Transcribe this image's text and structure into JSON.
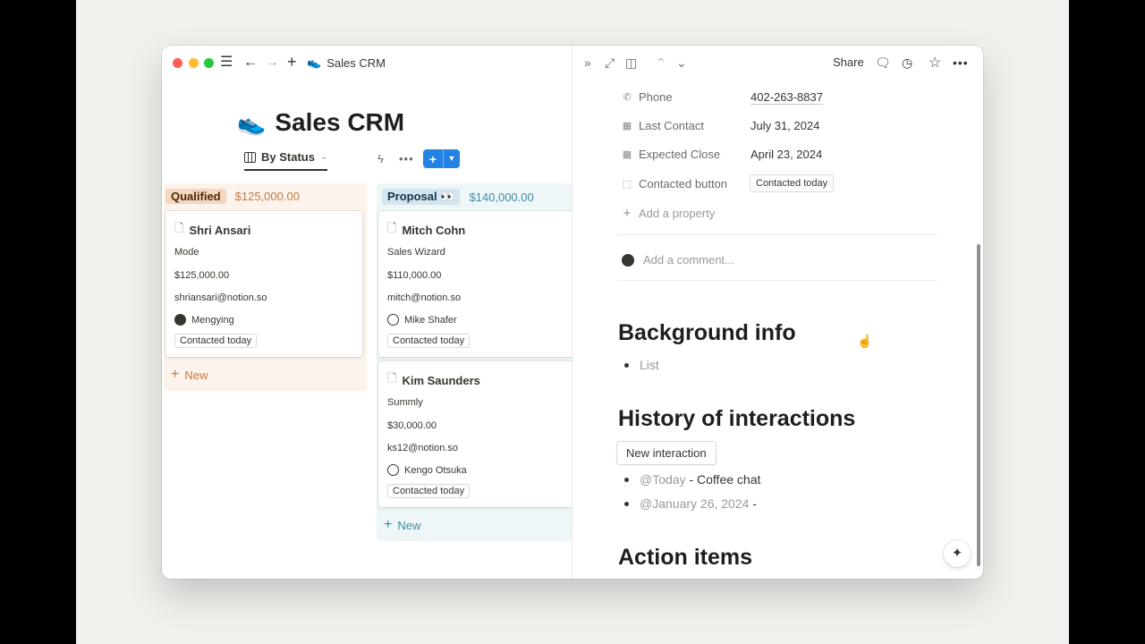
{
  "app": {
    "breadcrumb_emoji": "👟",
    "breadcrumb_title": "Sales CRM"
  },
  "page": {
    "emoji": "👟",
    "title": "Sales CRM",
    "view_label": "By Status"
  },
  "board": {
    "columns": [
      {
        "status": "Qualified",
        "total": "$125,000.00",
        "new_label": "New",
        "cards": [
          {
            "name": "Shri Ansari",
            "company": "Mode",
            "value": "$125,000.00",
            "email": "shriansari@notion.so",
            "owner": "Mengying",
            "tag": "Contacted today"
          }
        ]
      },
      {
        "status": "Proposal 👀",
        "total": "$140,000.00",
        "new_label": "New",
        "cards": [
          {
            "name": "Mitch Cohn",
            "company": "Sales Wizard",
            "value": "$110,000.00",
            "email": "mitch@notion.so",
            "owner": "Mike Shafer",
            "tag": "Contacted today"
          },
          {
            "name": "Kim Saunders",
            "company": "Summly",
            "value": "$30,000.00",
            "email": "ks12@notion.so",
            "owner": "Kengo Otsuka",
            "tag": "Contacted today"
          }
        ]
      }
    ]
  },
  "detail": {
    "share_label": "Share",
    "properties": [
      {
        "label": "Phone",
        "value": "402-263-8837"
      },
      {
        "label": "Last Contact",
        "value": "July 31, 2024"
      },
      {
        "label": "Expected Close",
        "value": "April 23, 2024"
      },
      {
        "label": "Contacted button",
        "value": "Contacted today"
      }
    ],
    "add_property": "Add a property",
    "comment_placeholder": "Add a comment...",
    "background_heading": "Background info",
    "background_items": [
      "List"
    ],
    "history_heading": "History of interactions",
    "new_interaction_label": "New interaction",
    "history_items": [
      {
        "mention": "@Today",
        "text": " - Coffee chat"
      },
      {
        "mention": "@January 26, 2024",
        "text": " -"
      }
    ],
    "action_heading": "Action items"
  }
}
